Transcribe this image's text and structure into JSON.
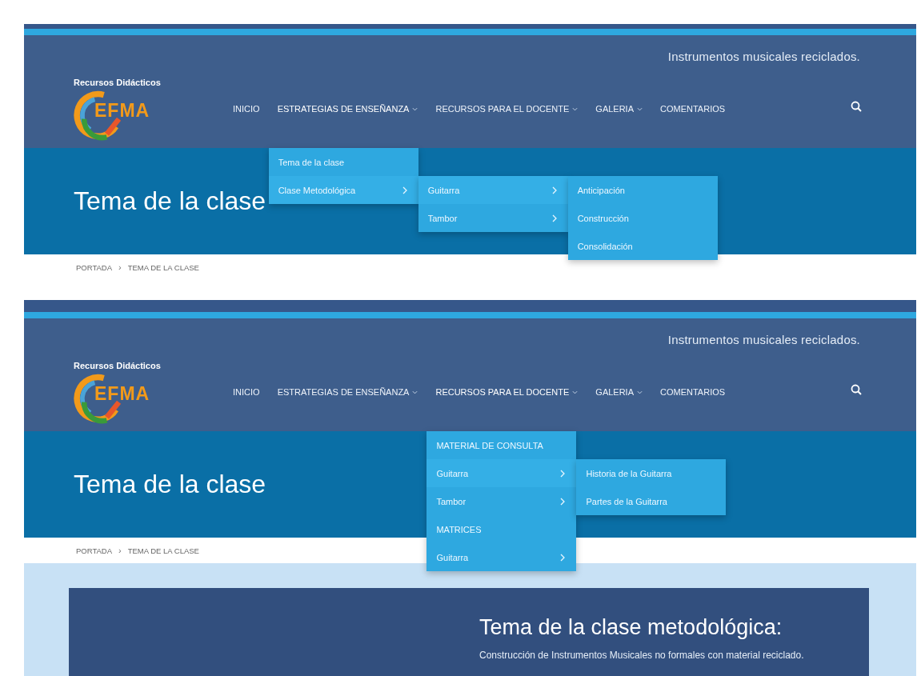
{
  "screens": [
    {
      "site_label": "Recursos Didácticos",
      "logo_text": "EFMA",
      "tagline": "Instrumentos musicales reciclados.",
      "nav": [
        {
          "label": "INICIO",
          "kind": "link"
        },
        {
          "label": "ESTRATEGIAS DE ENSEÑANZA",
          "kind": "dropdown",
          "expanded": true,
          "menu": [
            {
              "label": "Tema de la clase",
              "kind": "link"
            },
            {
              "label": "Clase Metodológica",
              "kind": "submenu",
              "expanded": true,
              "children": [
                {
                  "label": "Guitarra",
                  "kind": "submenu",
                  "expanded": true,
                  "children": [
                    {
                      "label": "Anticipación",
                      "kind": "link"
                    },
                    {
                      "label": "Construcción",
                      "kind": "link"
                    },
                    {
                      "label": "Consolidación",
                      "kind": "link"
                    }
                  ]
                },
                {
                  "label": "Tambor",
                  "kind": "submenu",
                  "expanded": false
                }
              ]
            }
          ]
        },
        {
          "label": "RECURSOS PARA EL DOCENTE",
          "kind": "dropdown",
          "expanded": false
        },
        {
          "label": "GALERIA",
          "kind": "dropdown",
          "expanded": false
        },
        {
          "label": "COMENTARIOS",
          "kind": "link"
        }
      ],
      "hero_title": "Tema de la clase",
      "breadcrumb": [
        {
          "label": "PORTADA"
        },
        {
          "label": "TEMA DE LA CLASE"
        }
      ],
      "breadcrumb_separator": "›"
    },
    {
      "site_label": "Recursos Didácticos",
      "logo_text": "EFMA",
      "tagline": "Instrumentos musicales reciclados.",
      "nav": [
        {
          "label": "INICIO",
          "kind": "link"
        },
        {
          "label": "ESTRATEGIAS DE ENSEÑANZA",
          "kind": "dropdown",
          "expanded": false
        },
        {
          "label": "RECURSOS PARA EL DOCENTE",
          "kind": "dropdown",
          "expanded": true,
          "menu": [
            {
              "label": "MATERIAL DE CONSULTA",
              "kind": "link"
            },
            {
              "label": "Guitarra",
              "kind": "submenu",
              "expanded": true,
              "children": [
                {
                  "label": "Historia de la Guitarra",
                  "kind": "link"
                },
                {
                  "label": "Partes de la Guitarra",
                  "kind": "link"
                }
              ]
            },
            {
              "label": "Tambor",
              "kind": "submenu",
              "expanded": false
            },
            {
              "label": "MATRICES",
              "kind": "link"
            },
            {
              "label": "Guitarra",
              "kind": "submenu",
              "expanded": false
            }
          ]
        },
        {
          "label": "GALERIA",
          "kind": "dropdown",
          "expanded": false
        },
        {
          "label": "COMENTARIOS",
          "kind": "link"
        }
      ],
      "hero_title": "Tema de la clase",
      "breadcrumb": [
        {
          "label": "PORTADA"
        },
        {
          "label": "TEMA DE LA CLASE"
        }
      ],
      "breadcrumb_separator": "›",
      "content": {
        "title": "Tema de la clase metodológica:",
        "text": "Construcción de Instrumentos Musicales no formales con material reciclado."
      }
    }
  ]
}
